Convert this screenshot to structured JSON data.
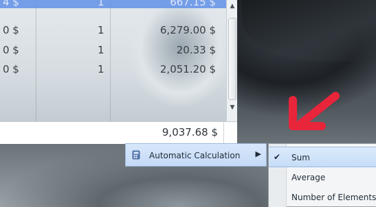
{
  "grid": {
    "rows": [
      {
        "currency": "4 $",
        "quantity": "1",
        "amount": "667.15 $"
      },
      {
        "currency": "0 $",
        "quantity": "1",
        "amount": "6,279.00 $"
      },
      {
        "currency": "0 $",
        "quantity": "1",
        "amount": "20.33 $"
      },
      {
        "currency": "0 $",
        "quantity": "1",
        "amount": "2,051.20 $"
      }
    ],
    "total": "9,037.68 $"
  },
  "context_menu": {
    "item_label": "Automatic Calculation",
    "submenu_arrow": "▶"
  },
  "submenu": {
    "items": [
      {
        "label": "Sum",
        "checked": true,
        "check_glyph": "✔"
      },
      {
        "label": "Average",
        "checked": false
      },
      {
        "label": "Number of Elements",
        "checked": false
      }
    ]
  },
  "scroll": {
    "up_glyph": "▲",
    "down_glyph": "▼"
  },
  "colors": {
    "selected_row": "#6291e8",
    "menu_highlight": "#c6dcf6",
    "annotation_arrow": "#e8253a"
  }
}
